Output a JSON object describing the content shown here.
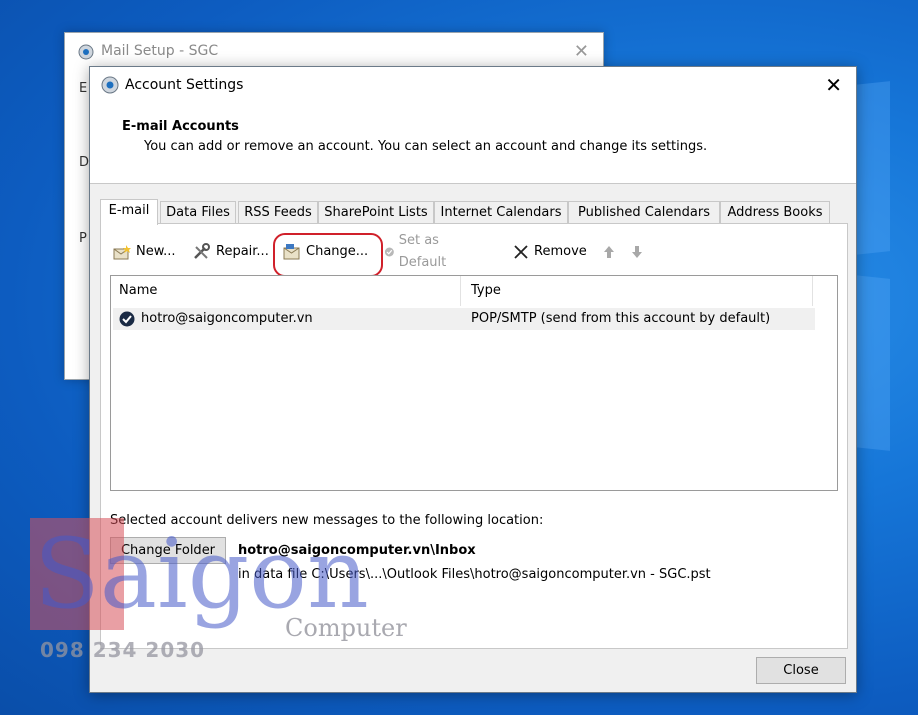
{
  "back_window": {
    "title": "Mail Setup - SGC",
    "close_glyph": "✕",
    "side_letters": [
      "E",
      "D",
      "P"
    ]
  },
  "dialog": {
    "title": "Account Settings",
    "close_glyph": "✕",
    "header_title": "E-mail Accounts",
    "header_subtitle": "You can add or remove an account. You can select an account and change its settings."
  },
  "tabs": [
    "E-mail",
    "Data Files",
    "RSS Feeds",
    "SharePoint Lists",
    "Internet Calendars",
    "Published Calendars",
    "Address Books"
  ],
  "toolbar": {
    "new": "New...",
    "repair": "Repair...",
    "change": "Change...",
    "set_default": "Set as Default",
    "remove": "Remove"
  },
  "account_list": {
    "columns": [
      "Name",
      "Type"
    ],
    "rows": [
      {
        "name": "hotro@saigoncomputer.vn",
        "type": "POP/SMTP (send from this account by default)"
      }
    ]
  },
  "delivery": {
    "label": "Selected account delivers new messages to the following location:",
    "change_folder": "Change Folder",
    "path": "hotro@saigoncomputer.vn\\Inbox",
    "file": "in data file C:\\Users\\...\\Outlook Files\\hotro@saigoncomputer.vn - SGC.pst"
  },
  "footer": {
    "close": "Close"
  },
  "watermark": {
    "word": "Saigon",
    "sub": "Computer",
    "phone": "098 234 2030"
  },
  "colors": {
    "highlight_ring": "#d0202a",
    "desktop": "#1676d8"
  }
}
